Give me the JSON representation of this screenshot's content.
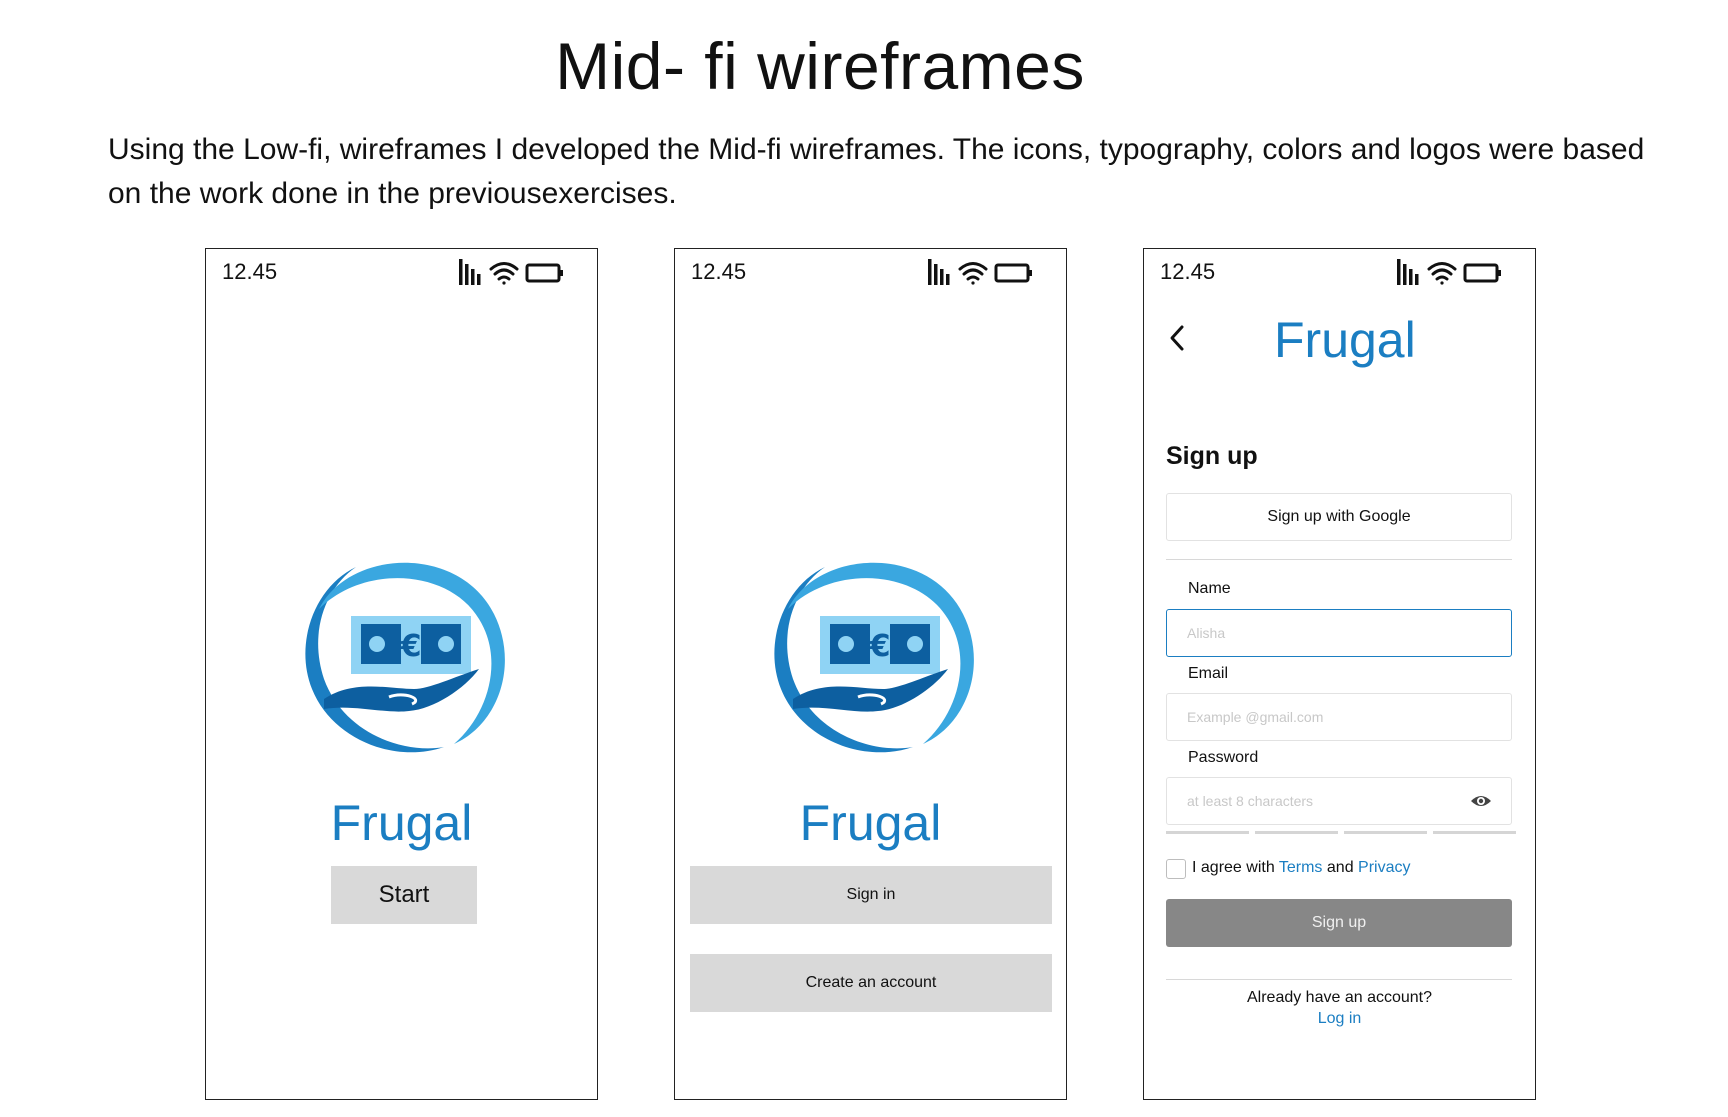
{
  "heading": {
    "title": "Mid- fi wireframes",
    "description": "Using the Low-fi, wireframes I developed the Mid-fi wireframes. The icons, typography, colors and logos were based on the work done in the previousexercises."
  },
  "colors": {
    "brand_blue": "#1b7ec2",
    "logo_light_blue": "#3aa7e0",
    "bill_light": "#8fd3f4",
    "button_grey": "#d9d9d9",
    "button_dark_grey": "#878787"
  },
  "status_bar": {
    "time": "12.45",
    "icons": [
      "signal-bars-icon",
      "wifi-icon",
      "battery-icon"
    ]
  },
  "screen1": {
    "brand": "Frugal",
    "start_label": "Start"
  },
  "screen2": {
    "brand": "Frugal",
    "signin_label": "Sign in",
    "create_label": "Create an account"
  },
  "screen3": {
    "brand": "Frugal",
    "heading": "Sign up",
    "google_label": "Sign up with Google",
    "name_label": "Name",
    "name_placeholder": "Alisha",
    "email_label": "Email",
    "email_placeholder": "Example @gmail.com",
    "password_label": "Password",
    "password_placeholder": "at least 8 characters",
    "agree_prefix": "I agree with",
    "terms": "Terms",
    "and": "and",
    "privacy": "Privacy",
    "signup_label": "Sign up",
    "already": "Already have an account?",
    "login": "Log in"
  }
}
